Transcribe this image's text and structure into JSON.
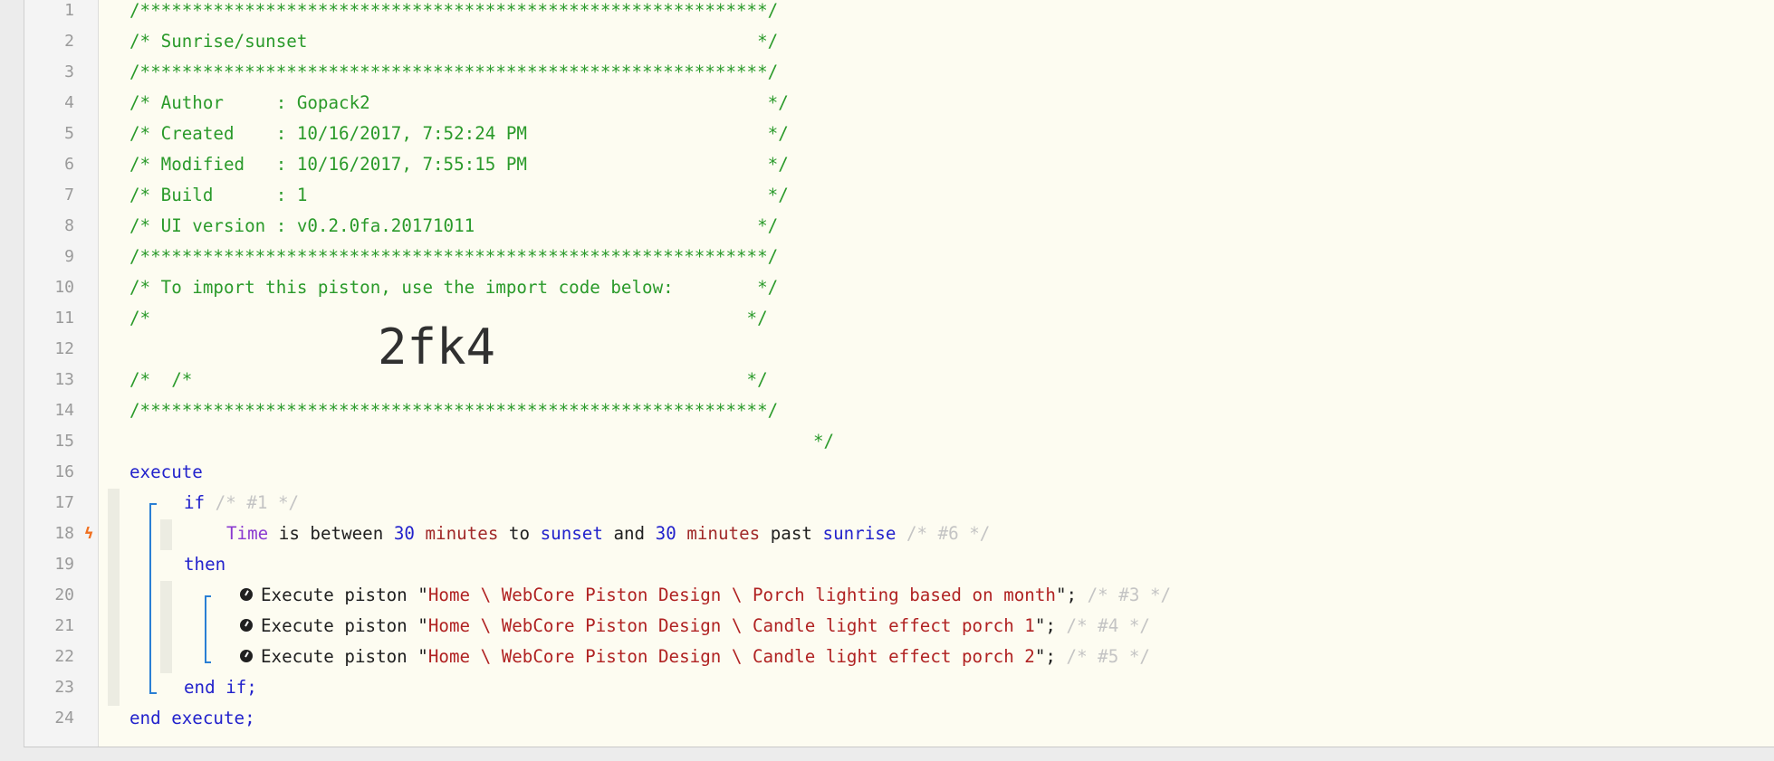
{
  "lines": [
    "1",
    "2",
    "3",
    "4",
    "5",
    "6",
    "7",
    "8",
    "9",
    "10",
    "11",
    "12",
    "13",
    "14",
    "15",
    "16",
    "17",
    "18",
    "19",
    "20",
    "21",
    "22",
    "23",
    "24"
  ],
  "code": {
    "stars": "/************************************************************/",
    "title": "/* Sunrise/sunset                                           */",
    "author": "/* Author     : Gopack2                                      */",
    "created": "/* Created    : 10/16/2017, 7:52:24 PM                       */",
    "modified": "/* Modified   : 10/16/2017, 7:55:15 PM                       */",
    "build": "/* Build      : 1                                            */",
    "ui_version": "/* UI version : v0.2.0fa.20171011                           */",
    "import_note": "/* To import this piston, use the import code below:        */",
    "blank_comment": "/*                                                         */",
    "code_prefix": "/*",
    "code_suffix": "*/",
    "import_code": "2fk4",
    "execute": "execute",
    "if": "if",
    "if_comment": "/* #1 */",
    "cond_time": "Time",
    "cond_is_between": " is between ",
    "cond_30a": "30",
    "cond_minutes_a": " minutes",
    "cond_to": " to ",
    "cond_sunset": "sunset",
    "cond_and": " and ",
    "cond_30b": "30",
    "cond_minutes_b": " minutes",
    "cond_past": " past ",
    "cond_sunrise": "sunrise",
    "cond_comment": " /* #6 */",
    "then": "then",
    "exec_prefix": "Execute piston \"",
    "exec1_str": "Home \\ WebCore Piston Design \\ Porch lighting based on month",
    "exec1_comment": " /* #3 */",
    "exec2_str": "Home \\ WebCore Piston Design \\ Candle light effect porch 1",
    "exec2_comment": " /* #4 */",
    "exec3_str": "Home \\ WebCore Piston Design \\ Candle light effect porch 2",
    "exec3_comment": " /* #5 */",
    "exec_suffix": "\";",
    "end_if": "end if;",
    "end_execute": "end execute;"
  },
  "gutter_marker": "ϟ",
  "colors": {
    "comment": "#2a9a2a",
    "keyword": "#2222cc",
    "string": "#b02222",
    "guide": "#2a7fd4",
    "background": "#fdfcf1"
  },
  "icons": {
    "execute_piston": "clock-icon",
    "trigger": "lightning-icon"
  }
}
